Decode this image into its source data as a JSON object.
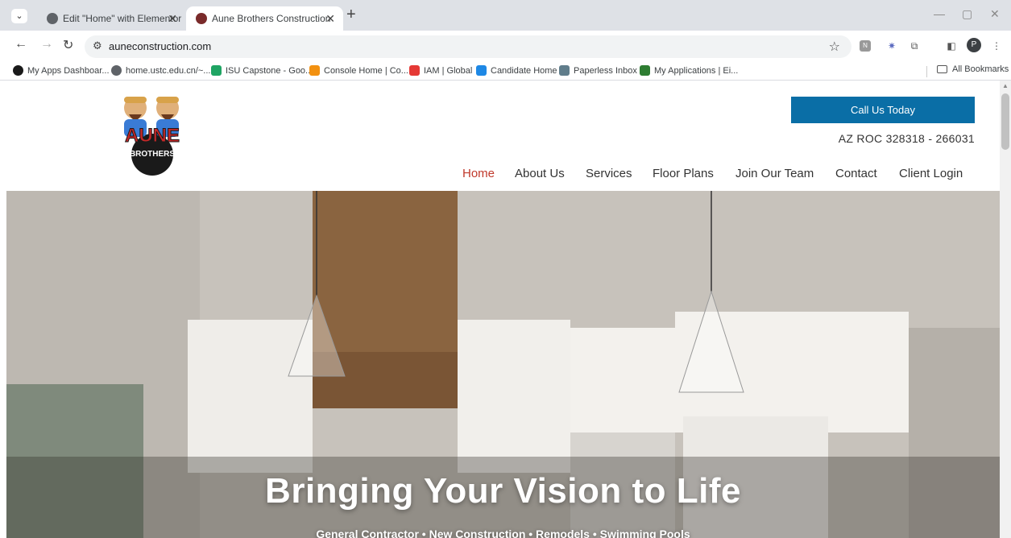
{
  "browser": {
    "tabs": [
      {
        "title": "Edit \"Home\" with Elementor",
        "active": false
      },
      {
        "title": "Aune Brothers Construction",
        "active": true
      }
    ],
    "url": "auneconstruction.com",
    "profile_initial": "P",
    "bookmarks": [
      {
        "label": "My Apps Dashboar...",
        "color": "#1a1a1a"
      },
      {
        "label": "home.ustc.edu.cn/~...",
        "color": "#5f6368"
      },
      {
        "label": "ISU Capstone - Goo...",
        "color": "#1fa463"
      },
      {
        "label": "Console Home | Co...",
        "color": "#f29111"
      },
      {
        "label": "IAM | Global",
        "color": "#e53935"
      },
      {
        "label": "Candidate Home",
        "color": "#1e88e5"
      },
      {
        "label": "Paperless Inbox",
        "color": "#607d8b"
      },
      {
        "label": "My Applications | Ei...",
        "color": "#2e7d32"
      }
    ],
    "all_bookmarks": "All Bookmarks"
  },
  "header": {
    "logo_text": "AUNE BROTHERS",
    "cta_label": "Call Us Today",
    "license": "AZ ROC 328318 - 266031",
    "nav": [
      {
        "label": "Home",
        "active": true
      },
      {
        "label": "About Us",
        "active": false
      },
      {
        "label": "Services",
        "active": false
      },
      {
        "label": "Floor Plans",
        "active": false
      },
      {
        "label": "Join Our Team",
        "active": false
      },
      {
        "label": "Contact",
        "active": false
      },
      {
        "label": "Client Login",
        "active": false
      }
    ]
  },
  "hero": {
    "title": "Bringing Your Vision to Life",
    "subtitle": "General Contractor • New Construction • Remodels • Swimming Pools"
  },
  "colors": {
    "accent": "#0a6ea6",
    "nav_active": "#c0392b"
  }
}
